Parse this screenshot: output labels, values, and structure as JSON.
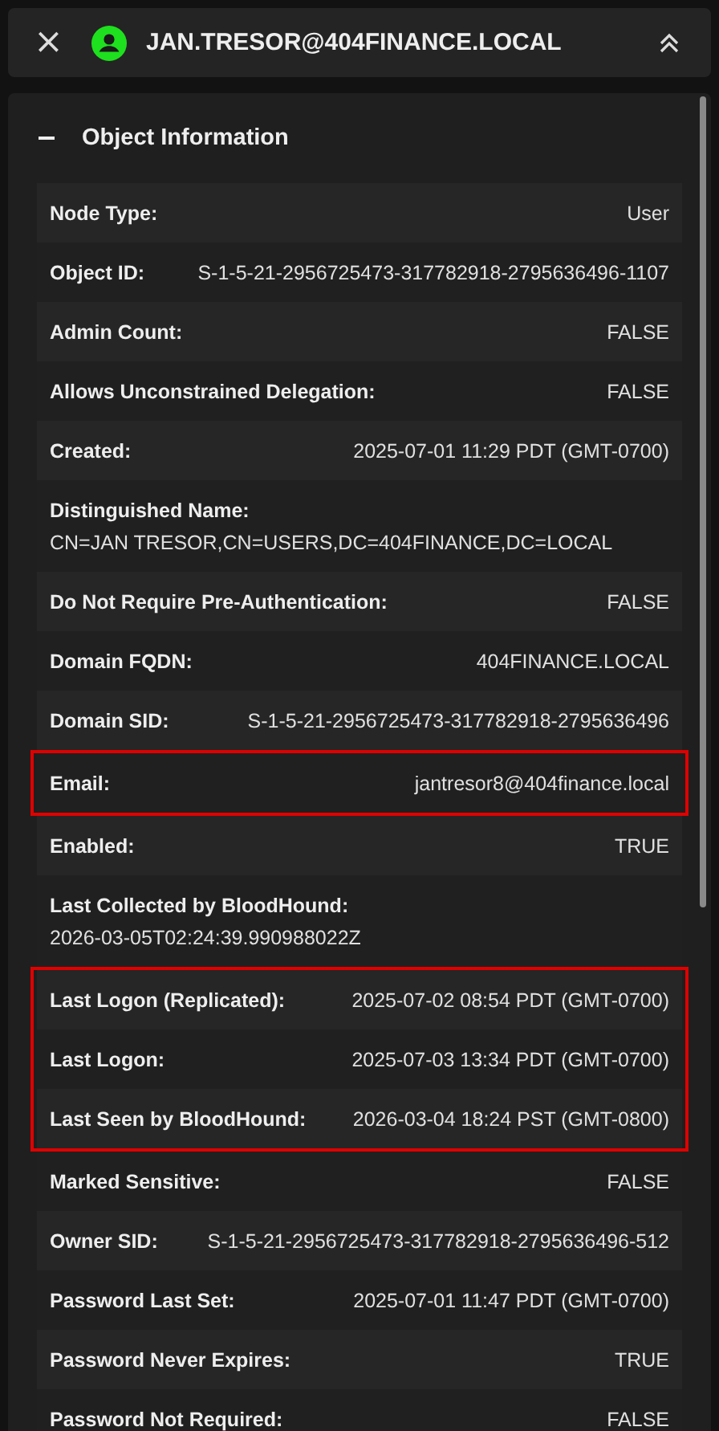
{
  "header": {
    "close": "×",
    "title": "JAN.TRESOR@404FINANCE.LOCAL"
  },
  "section": {
    "title": "Object Information",
    "expanded": true,
    "rows": [
      {
        "kind": "row",
        "label": "Node Type:",
        "value": "User"
      },
      {
        "kind": "row",
        "label": "Object ID:",
        "value": "S-1-5-21-2956725473-317782918-2795636496-1107"
      },
      {
        "kind": "row",
        "label": "Admin Count:",
        "value": "FALSE"
      },
      {
        "kind": "row",
        "label": "Allows Unconstrained Delegation:",
        "value": "FALSE"
      },
      {
        "kind": "row",
        "label": "Created:",
        "value": "2025-07-01 11:29 PDT (GMT-0700)"
      },
      {
        "kind": "stacked",
        "label": "Distinguished Name:",
        "value": "CN=JAN TRESOR,CN=USERS,DC=404FINANCE,DC=LOCAL"
      },
      {
        "kind": "row",
        "label": "Do Not Require Pre-Authentication:",
        "value": "FALSE"
      },
      {
        "kind": "row",
        "label": "Domain FQDN:",
        "value": "404FINANCE.LOCAL"
      },
      {
        "kind": "row",
        "label": "Domain SID:",
        "value": "S-1-5-21-2956725473-317782918-2795636496"
      },
      {
        "kind": "highlight",
        "rows": [
          {
            "kind": "row",
            "label": "Email:",
            "value": "jantresor8@404finance.local"
          }
        ]
      },
      {
        "kind": "row",
        "label": "Enabled:",
        "value": "TRUE"
      },
      {
        "kind": "stacked",
        "label": "Last Collected by BloodHound:",
        "value": "2026-03-05T02:24:39.990988022Z"
      },
      {
        "kind": "highlight",
        "rows": [
          {
            "kind": "row",
            "label": "Last Logon (Replicated):",
            "value": "2025-07-02 08:54 PDT (GMT-0700)"
          },
          {
            "kind": "row",
            "label": "Last Logon:",
            "value": "2025-07-03 13:34 PDT (GMT-0700)"
          },
          {
            "kind": "row",
            "label": "Last Seen by BloodHound:",
            "value": "2026-03-04 18:24 PST (GMT-0800)"
          }
        ]
      },
      {
        "kind": "row",
        "label": "Marked Sensitive:",
        "value": "FALSE"
      },
      {
        "kind": "row",
        "label": "Owner SID:",
        "value": "S-1-5-21-2956725473-317782918-2795636496-512"
      },
      {
        "kind": "row",
        "label": "Password Last Set:",
        "value": "2025-07-01 11:47 PDT (GMT-0700)"
      },
      {
        "kind": "row",
        "label": "Password Never Expires:",
        "value": "TRUE"
      },
      {
        "kind": "row",
        "label": "Password Not Required:",
        "value": "FALSE"
      }
    ]
  }
}
